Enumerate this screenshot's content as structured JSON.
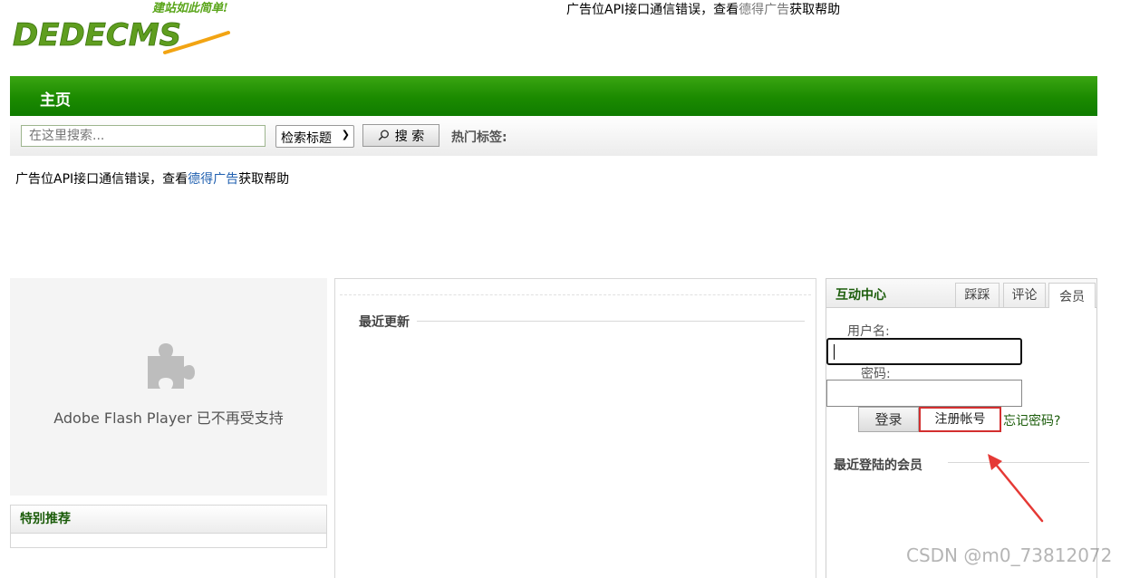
{
  "header": {
    "logo_text": "DEDECMS",
    "logo_slogan": "建站如此简单!",
    "ad_text_prefix": "广告位API接口通信错误，查看",
    "ad_link": "德得广告",
    "ad_text_suffix": "获取帮助"
  },
  "nav": {
    "home": "主页"
  },
  "search": {
    "placeholder": "在这里搜索...",
    "select_value": "检索标题",
    "button_label": "搜 索",
    "hot_tags_label": "热门标签:"
  },
  "mid_ad": {
    "prefix": "广告位API接口通信错误，查看",
    "link": "德得广告",
    "suffix": "获取帮助"
  },
  "flash": {
    "message": "Adobe Flash Player 已不再受支持",
    "icon": "puzzle-piece-icon"
  },
  "recommend": {
    "title": "特别推荐"
  },
  "middle": {
    "recent_title": "最近更新"
  },
  "interactive": {
    "title": "互动中心",
    "tabs": [
      "踩踩",
      "评论",
      "会员"
    ],
    "active_tab": "会员",
    "username_label": "用户名:",
    "password_label": "密码:",
    "login_button": "登录",
    "register_button": "注册帐号",
    "forgot_link": "忘记密码?",
    "recent_members": "最近登陆的会员"
  },
  "watermark": "CSDN @m0_73812072",
  "colors": {
    "nav_green": "#1b8a00",
    "highlight_red": "#d32f2f",
    "title_green": "#1b5c0a"
  }
}
